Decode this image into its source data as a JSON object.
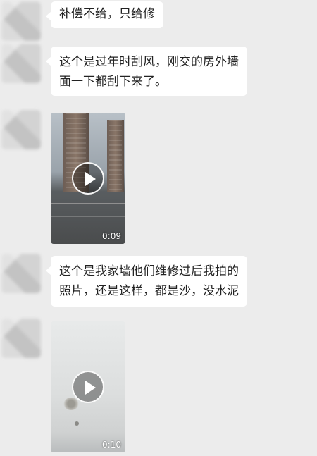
{
  "messages": [
    {
      "type": "text",
      "lines": [
        "补偿不给，只给修"
      ]
    },
    {
      "type": "text",
      "lines": [
        "这个是过年时刮风，刚交的房外墙",
        "面一下都刮下来了。"
      ]
    },
    {
      "type": "video",
      "duration": "0:09"
    },
    {
      "type": "text",
      "lines": [
        "这个是我家墙他们维修过后我拍的",
        "照片，还是这样，都是沙，没水泥"
      ]
    },
    {
      "type": "video",
      "duration": "0:10"
    }
  ],
  "icons": {
    "play": "play-icon",
    "avatar": "avatar-blurred"
  },
  "colors": {
    "background": "#ececec",
    "bubble": "#ffffff",
    "text": "#222222"
  }
}
